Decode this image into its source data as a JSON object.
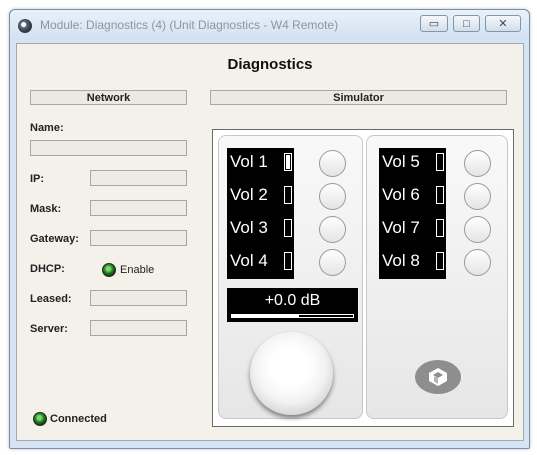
{
  "window": {
    "title": "Module: Diagnostics (4) (Unit Diagnostics - W4 Remote)",
    "min_label": "▭",
    "max_label": "□",
    "close_label": "✕"
  },
  "page": {
    "heading": "Diagnostics"
  },
  "network": {
    "section_label": "Network",
    "name_label": "Name:",
    "name_value": "",
    "ip_label": "IP:",
    "ip_value": "",
    "mask_label": "Mask:",
    "mask_value": "",
    "gateway_label": "Gateway:",
    "gateway_value": "",
    "dhcp_label": "DHCP:",
    "dhcp_enable_label": "Enable",
    "leased_label": "Leased:",
    "leased_value": "",
    "server_label": "Server:",
    "server_value": "",
    "status_label": "Connected"
  },
  "simulator": {
    "section_label": "Simulator",
    "volumes": [
      {
        "label": "Vol 1",
        "level": 1.0
      },
      {
        "label": "Vol 2",
        "level": 0
      },
      {
        "label": "Vol 3",
        "level": 0
      },
      {
        "label": "Vol 4",
        "level": 0
      },
      {
        "label": "Vol 5",
        "level": 0
      },
      {
        "label": "Vol 6",
        "level": 0
      },
      {
        "label": "Vol 7",
        "level": 0
      },
      {
        "label": "Vol 8",
        "level": 0
      }
    ],
    "db_value": "+0.0 dB",
    "db_bar_level": 0.55
  },
  "colors": {
    "led_green": "#2a8a2a",
    "display_bg": "#000000"
  },
  "icons": {
    "app": "app-icon",
    "logo": "cube-logo-icon",
    "led": "status-led-icon"
  }
}
